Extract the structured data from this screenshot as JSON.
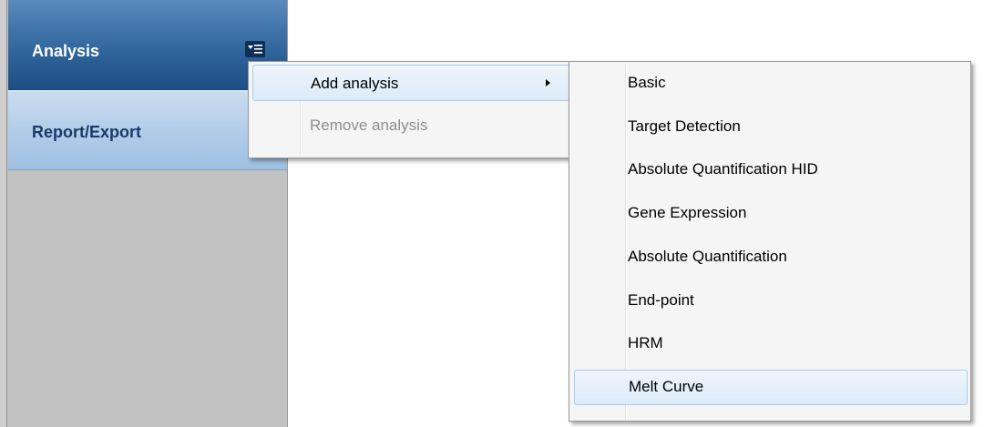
{
  "sidebar": {
    "analysis_label": "Analysis",
    "report_label": "Report/Export",
    "menu_toggle_icon": "menu-dropdown-icon"
  },
  "context_menu": {
    "items": [
      {
        "label": "Add analysis",
        "state": "highlighted",
        "has_submenu": true
      },
      {
        "label": "Remove analysis",
        "state": "disabled",
        "has_submenu": false
      }
    ]
  },
  "submenu": {
    "items": [
      {
        "label": "Basic"
      },
      {
        "label": "Target Detection"
      },
      {
        "label": "Absolute Quantification HID"
      },
      {
        "label": "Gene Expression"
      },
      {
        "label": "Absolute Quantification"
      },
      {
        "label": "End-point"
      },
      {
        "label": "HRM"
      },
      {
        "label": "Melt Curve",
        "state": "highlighted"
      }
    ]
  },
  "colors": {
    "analysis_header": "#295e95",
    "report_header": "#b3cde9",
    "menu_highlight": "#dcebf9",
    "sidebar_body": "#c2c2c2"
  }
}
